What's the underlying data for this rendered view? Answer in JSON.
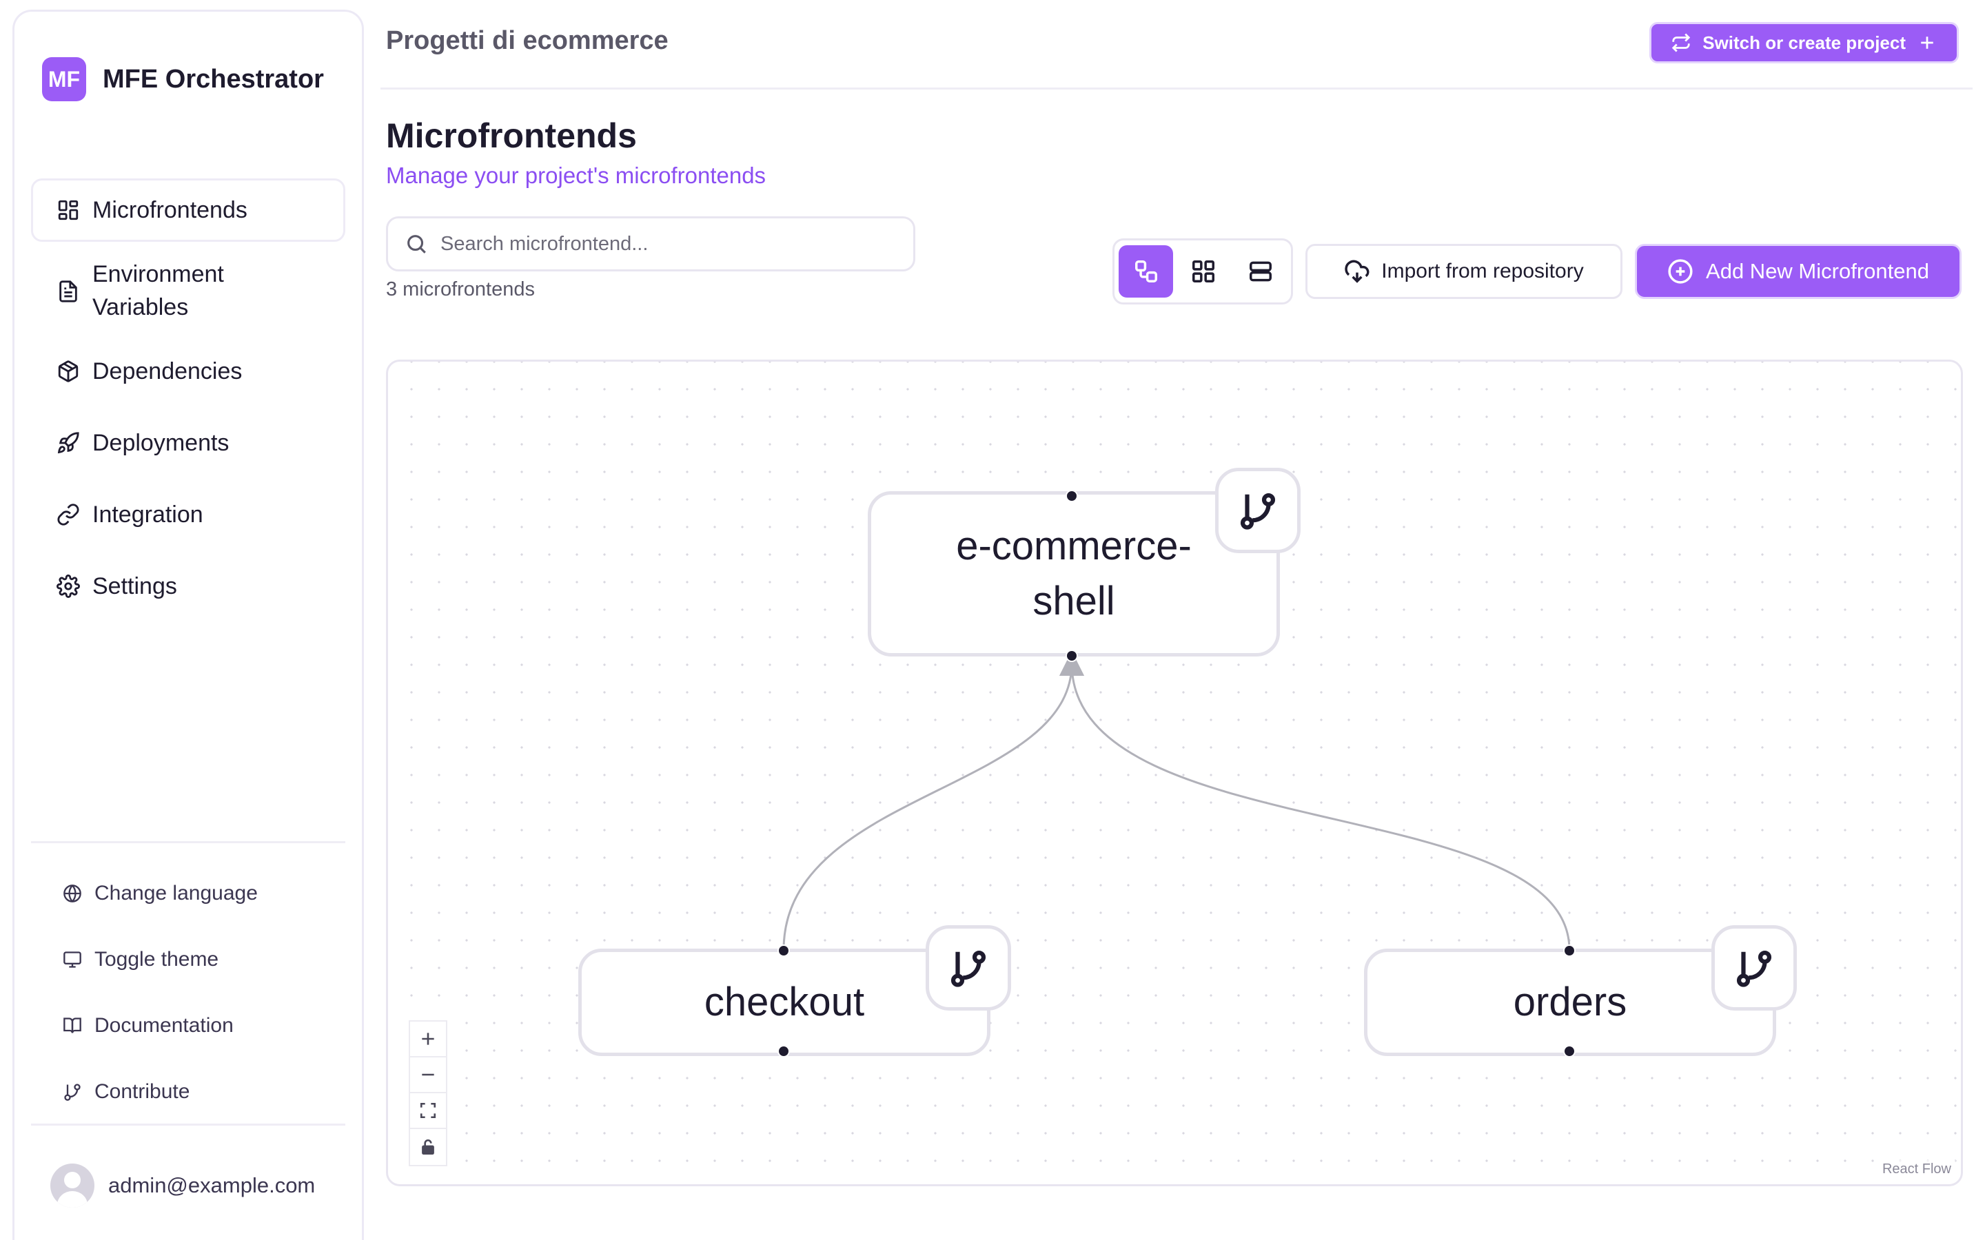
{
  "brand": {
    "logo": "MF",
    "name": "MFE Orchestrator"
  },
  "sidebar": {
    "items": [
      {
        "label": "Microfrontends",
        "icon": "layout-dashboard-icon",
        "active": true
      },
      {
        "label": "Environment Variables",
        "icon": "file-text-icon"
      },
      {
        "label": "Dependencies",
        "icon": "package-icon"
      },
      {
        "label": "Deployments",
        "icon": "rocket-icon"
      },
      {
        "label": "Integration",
        "icon": "link-icon"
      },
      {
        "label": "Settings",
        "icon": "gear-icon"
      }
    ],
    "utilities": [
      {
        "label": "Change language",
        "icon": "globe-icon"
      },
      {
        "label": "Toggle theme",
        "icon": "monitor-icon"
      },
      {
        "label": "Documentation",
        "icon": "book-open-icon"
      },
      {
        "label": "Contribute",
        "icon": "git-branch-icon"
      }
    ],
    "user": {
      "email": "admin@example.com"
    }
  },
  "header": {
    "project": "Progetti di ecommerce",
    "switch_label": "Switch or create project"
  },
  "main": {
    "title": "Microfrontends",
    "subtitle": "Manage your project's microfrontends",
    "search_placeholder": "Search microfrontend...",
    "count_label": "3 microfrontends",
    "import_label": "Import from repository",
    "add_label": "Add New Microfrontend"
  },
  "flow": {
    "nodes": [
      {
        "id": "shell",
        "label": "e-commerce-shell"
      },
      {
        "id": "checkout",
        "label": "checkout"
      },
      {
        "id": "orders",
        "label": "orders"
      }
    ],
    "edges": [
      {
        "from": "checkout",
        "to": "shell"
      },
      {
        "from": "orders",
        "to": "shell"
      }
    ],
    "attribution": "React Flow"
  },
  "colors": {
    "accent": "#9b5cf6",
    "accent_text": "#8b4ef2",
    "text": "#1e1b2e",
    "border": "#e8e5f0"
  }
}
